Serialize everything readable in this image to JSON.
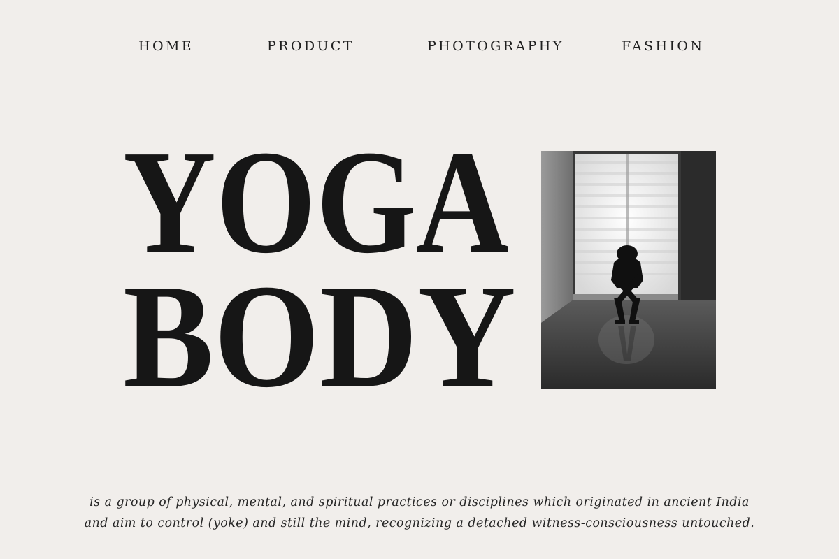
{
  "nav": {
    "items": [
      {
        "label": "HOME"
      },
      {
        "label": "PRODUCT"
      },
      {
        "label": "PHOTOGRAPHY"
      },
      {
        "label": "FASHION"
      }
    ]
  },
  "hero": {
    "title_line1": "YOGA",
    "title_line2": "BODY",
    "photo_icon": "yoga-pose-photo"
  },
  "description": {
    "line1": "is a group of physical, mental, and spiritual practices or disciplines which originated in ancient India",
    "line2": "and aim to control (yoke) and still the mind, recognizing a detached witness-consciousness untouched."
  },
  "colors": {
    "background": "#f1eeeb",
    "text": "#1b1b1b"
  }
}
